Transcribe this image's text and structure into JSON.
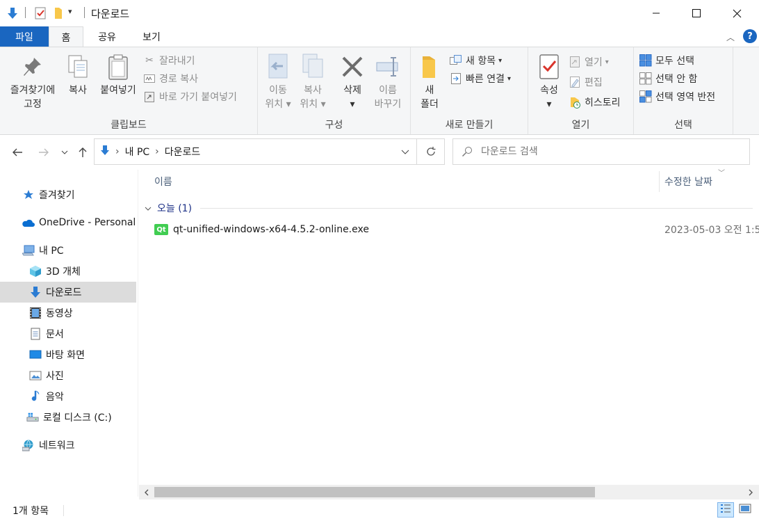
{
  "window": {
    "title": "다운로드"
  },
  "quick_access": {
    "items": [
      "down-arrow-icon",
      "properties-check-icon",
      "new-folder-icon",
      "customize-dropdown-icon"
    ]
  },
  "tabs": [
    {
      "label": "파일"
    },
    {
      "label": "홈"
    },
    {
      "label": "공유"
    },
    {
      "label": "보기"
    }
  ],
  "ribbon": {
    "clipboard": {
      "label": "클립보드",
      "pin_line1": "즐겨찾기에",
      "pin_line2": "고정",
      "copy": "복사",
      "paste": "붙여넣기",
      "cut": "잘라내기",
      "copy_path": "경로 복사",
      "paste_shortcut": "바로 가기 붙여넣기"
    },
    "organize": {
      "label": "구성",
      "move_line1": "이동",
      "move_line2": "위치",
      "copy_line1": "복사",
      "copy_line2": "위치",
      "delete": "삭제",
      "rename_line1": "이름",
      "rename_line2": "바꾸기"
    },
    "new": {
      "label": "새로 만들기",
      "folder_line1": "새",
      "folder_line2": "폴더",
      "new_item": "새 항목",
      "easy_access": "빠른 연결"
    },
    "open": {
      "label": "열기",
      "properties": "속성",
      "open": "열기",
      "edit": "편집",
      "history": "히스토리"
    },
    "select": {
      "label": "선택",
      "select_all": "모두 선택",
      "select_none": "선택 안 함",
      "invert": "선택 영역 반전"
    }
  },
  "address": {
    "crumbs": [
      "내 PC",
      "다운로드"
    ]
  },
  "search": {
    "placeholder": "다운로드 검색"
  },
  "nav": {
    "favorites": "즐겨찾기",
    "onedrive": "OneDrive - Personal",
    "this_pc": "내 PC",
    "objects3d": "3D 개체",
    "downloads": "다운로드",
    "videos": "동영상",
    "documents": "문서",
    "desktop": "바탕 화면",
    "pictures": "사진",
    "music": "음악",
    "local_disk": "로컬 디스크 (C:)",
    "network": "네트워크"
  },
  "columns": {
    "name": "이름",
    "modified": "수정한 날짜"
  },
  "group": {
    "label": "오늘 (1)"
  },
  "files": [
    {
      "name": "qt-unified-windows-x64-4.5.2-online.exe",
      "modified": "2023-05-03 오전 1:5"
    }
  ],
  "status": {
    "count": "1개 항목"
  },
  "colors": {
    "accent": "#1a66c0",
    "folder": "#f8c74a",
    "selected": "#dcdcdc",
    "qt_green": "#41cd52"
  }
}
